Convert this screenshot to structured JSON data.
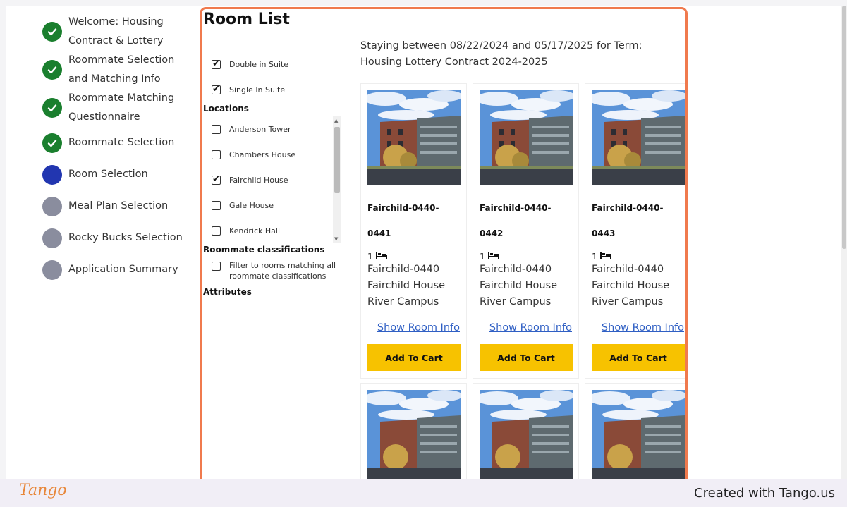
{
  "steps": [
    {
      "label_line1": "Welcome: Housing",
      "label_line2": "Contract & Lottery",
      "status": "done"
    },
    {
      "label_line1": "Roommate Selection",
      "label_line2": "and Matching Info",
      "status": "done"
    },
    {
      "label_line1": "Roommate Matching",
      "label_line2": "Questionnaire",
      "status": "done"
    },
    {
      "label_line1": "Roommate Selection",
      "label_line2": "",
      "status": "done"
    },
    {
      "label_line1": "Room Selection",
      "label_line2": "",
      "status": "current"
    },
    {
      "label_line1": "Meal Plan Selection",
      "label_line2": "",
      "status": "todo"
    },
    {
      "label_line1": "Rocky Bucks Selection",
      "label_line2": "",
      "status": "todo"
    },
    {
      "label_line1": "Application Summary",
      "label_line2": "",
      "status": "todo"
    }
  ],
  "room_list": {
    "title": "Room List",
    "room_types": [
      {
        "label": "Double in Suite",
        "checked": true
      },
      {
        "label": "Single In Suite",
        "checked": true
      }
    ],
    "locations_title": "Locations",
    "locations": [
      {
        "label": "Anderson Tower",
        "checked": false
      },
      {
        "label": "Chambers House",
        "checked": false
      },
      {
        "label": "Fairchild House",
        "checked": true
      },
      {
        "label": "Gale House",
        "checked": false
      },
      {
        "label": "Kendrick Hall",
        "checked": false
      }
    ],
    "roommate_title": "Roommate classifications",
    "roommate_filter": {
      "label": "Filter to rooms matching all roommate classifications",
      "checked": false
    },
    "attributes_title": "Attributes",
    "stay_text": "Staying between 08/22/2024 and 05/17/2025 for Term: Housing Lottery Contract 2024-2025",
    "cards": [
      {
        "name": "Fairchild-0440-0441",
        "beds": "1",
        "suite": "Fairchild-0440",
        "building": "Fairchild House",
        "campus": "River Campus",
        "link": "Show Room Info",
        "button": "Add To Cart"
      },
      {
        "name": "Fairchild-0440-0442",
        "beds": "1",
        "suite": "Fairchild-0440",
        "building": "Fairchild House",
        "campus": "River Campus",
        "link": "Show Room Info",
        "button": "Add To Cart"
      },
      {
        "name": "Fairchild-0440-0443",
        "beds": "1",
        "suite": "Fairchild-0440",
        "building": "Fairchild House",
        "campus": "River Campus",
        "link": "Show Room Info",
        "button": "Add To Cart"
      }
    ]
  },
  "footer": {
    "logo": "Tango",
    "created": "Created with Tango.us"
  },
  "colors": {
    "done": "#1a7f2e",
    "current": "#2236b0",
    "todo": "#8a8d9e",
    "button": "#f7c200",
    "highlight": "#f07a4e",
    "link": "#2f5fc4"
  }
}
